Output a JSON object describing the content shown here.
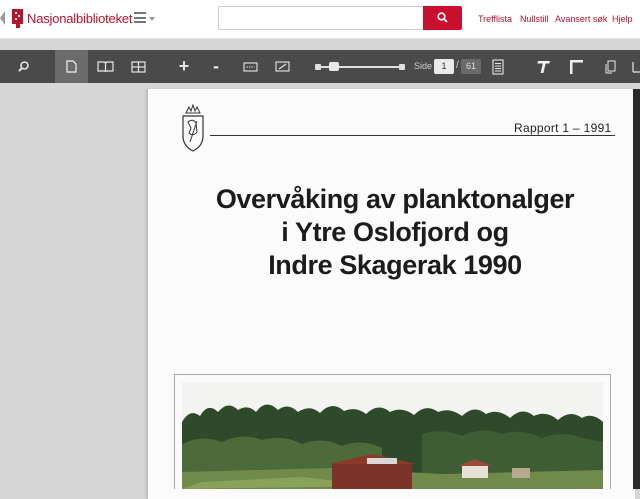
{
  "header": {
    "brand": "Nasjonalbiblioteket",
    "search": {
      "placeholder": "",
      "value": ""
    },
    "links": [
      "Trefflista",
      "Nullstill",
      "Avansert søk",
      "Hjelp"
    ]
  },
  "toolbar": {
    "page_label": "Side",
    "current_page": "1",
    "total_pages": "61",
    "zoom_in": "+",
    "zoom_out": "-"
  },
  "document": {
    "report_label": "Rapport 1 – 1991",
    "title_lines": [
      "Overvåking av planktonalger",
      "i Ytre Oslofjord og",
      "Indre Skagerak 1990"
    ]
  },
  "colors": {
    "brand": "#b8132a",
    "search_button": "#c8102e",
    "toolbar": "#4a4a4a",
    "viewer_bg": "#d6d6d6"
  },
  "icons": [
    "back-icon",
    "library-logo-icon",
    "menu-icon",
    "search-icon",
    "magnifier-icon",
    "single-page-icon",
    "book-view-icon",
    "grid-view-icon",
    "fit-width-icon",
    "fit-page-icon",
    "document-icon",
    "text-icon",
    "crop-icon",
    "copy-icon"
  ]
}
